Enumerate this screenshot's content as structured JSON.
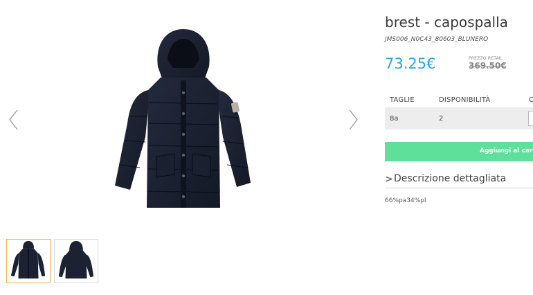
{
  "product": {
    "title": "brest - capospalla",
    "sku": "JMS006_N0C43_80603_BLUNERO",
    "price": "73.25€",
    "retail_label": "PREZZO RETAIL",
    "retail_price": "369.50€"
  },
  "table": {
    "headers": [
      "TAGLIE",
      "DISPONIBILITÀ",
      "C"
    ],
    "rows": [
      {
        "size": "8a",
        "availability": "2",
        "qty": ""
      }
    ]
  },
  "actions": {
    "add_to_cart": "Aggiungi al carr"
  },
  "description": {
    "toggle_label": "Descrizione dettagliata",
    "chevron": ">",
    "content": "66%pa34%pl"
  },
  "colors": {
    "price": "#29a6e0",
    "add_to_cart_bg": "#5ee09a",
    "thumb_active_border": "#f0b04a",
    "jacket": "#1c2233"
  },
  "icons": {
    "prev": "chevron-left-icon",
    "next": "chevron-right-icon"
  }
}
